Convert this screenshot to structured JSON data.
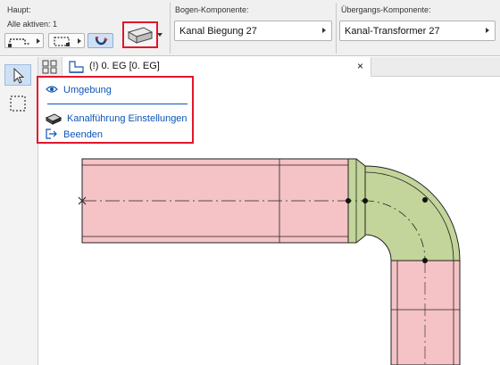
{
  "infobox": {
    "haupt_label": "Haupt:",
    "layers_label": "Alle aktiven: 1",
    "bogen_label": "Bogen-Komponente:",
    "bogen_value": "Kanal Biegung 27",
    "uebergang_label": "Übergangs-Komponente:",
    "uebergang_value": "Kanal-Transformer 27"
  },
  "tab": {
    "title": "(!) 0. EG [0. EG]",
    "close": "×"
  },
  "menu": {
    "items": [
      {
        "label": "Umgebung",
        "icon": "eye-icon"
      },
      {
        "label": "Kanalführung Einstellungen",
        "icon": "duct-settings-icon"
      },
      {
        "label": "Beenden",
        "icon": "exit-icon"
      }
    ]
  },
  "colors": {
    "duct_fill": "#f5c2c6",
    "bend_fill": "#c3d59a",
    "highlight_border": "#e3152b",
    "menu_text": "#0d55b5",
    "active_button": "#cfe0f4"
  }
}
